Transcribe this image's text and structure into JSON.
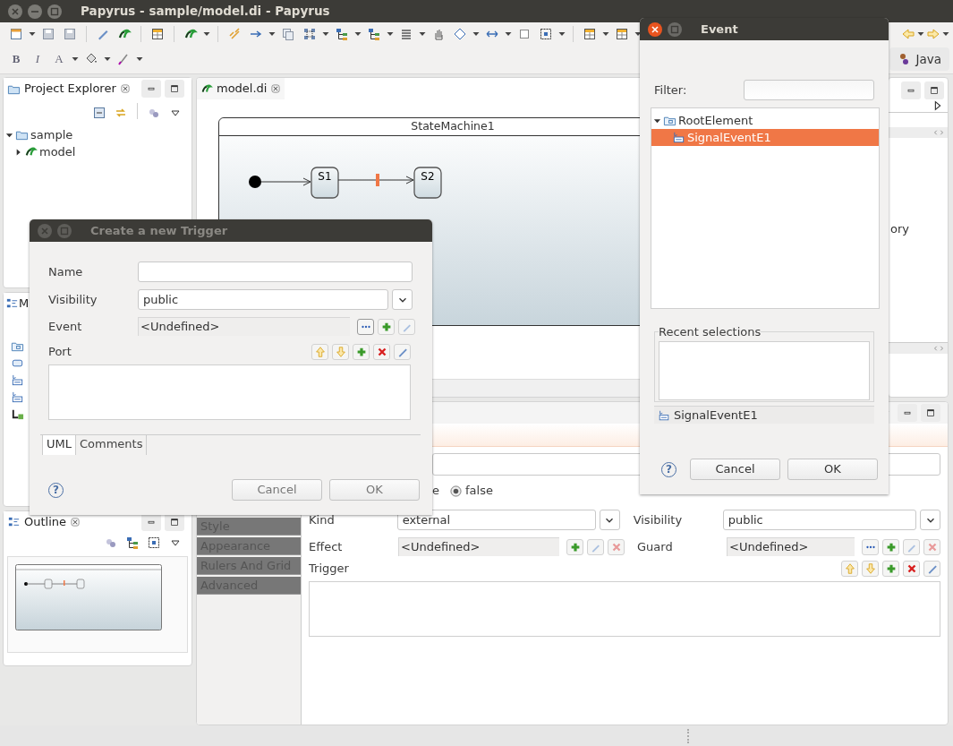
{
  "window": {
    "title": "Papyrus - sample/model.di - Papyrus"
  },
  "format_toolbar": [
    {
      "label": "B",
      "kind": "bold"
    },
    {
      "label": "I",
      "kind": "italic"
    },
    {
      "label": "A",
      "kind": "font"
    }
  ],
  "perspective": {
    "label": "Java"
  },
  "project_explorer": {
    "title": "Project Explorer",
    "tree": [
      {
        "label": "sample",
        "kind": "project",
        "expanded": true,
        "children": [
          {
            "label": "model",
            "kind": "model",
            "expanded": false
          }
        ]
      }
    ]
  },
  "model_explorer": {
    "title": "M"
  },
  "outline": {
    "title": "Outline"
  },
  "editor": {
    "tab": "model.di",
    "state_machine": {
      "name": "StateMachine1",
      "states": [
        "S1",
        "S2"
      ]
    }
  },
  "side_panel": {
    "fragment": "ory"
  },
  "properties": {
    "tabs": [
      {
        "label": "Style"
      },
      {
        "label": "Appearance"
      },
      {
        "label": "Rulers And Grid"
      },
      {
        "label": "Advanced"
      }
    ],
    "radio_fragment": "e",
    "radios": [
      {
        "label": "false",
        "selected": true
      }
    ],
    "kind": {
      "label": "Kind",
      "value": "external"
    },
    "visibility": {
      "label": "Visibility",
      "value": "public"
    },
    "effect": {
      "label": "Effect",
      "value": "<Undefined>"
    },
    "guard": {
      "label": "Guard",
      "value": "<Undefined>"
    },
    "trigger": {
      "label": "Trigger"
    }
  },
  "trigger_dialog": {
    "title": "Create a new Trigger",
    "active": false,
    "name_label": "Name",
    "visibility": {
      "label": "Visibility",
      "value": "public"
    },
    "event": {
      "label": "Event",
      "value": "<Undefined>"
    },
    "port_label": "Port",
    "tabs": [
      {
        "label": "UML",
        "selected": true
      },
      {
        "label": "Comments",
        "selected": false
      }
    ],
    "help": "?",
    "buttons": [
      "Cancel",
      "OK"
    ]
  },
  "event_dialog": {
    "title": "Event",
    "active": true,
    "filter_label": "Filter:",
    "tree": [
      {
        "label": "RootElement",
        "kind": "package",
        "expanded": true,
        "selected": false,
        "children": [
          {
            "label": "SignalEventE1",
            "kind": "signal_event",
            "selected": true
          }
        ]
      }
    ],
    "recent_label": "Recent selections",
    "status": "SignalEventE1",
    "help": "?",
    "buttons": [
      "Cancel",
      "OK"
    ]
  }
}
